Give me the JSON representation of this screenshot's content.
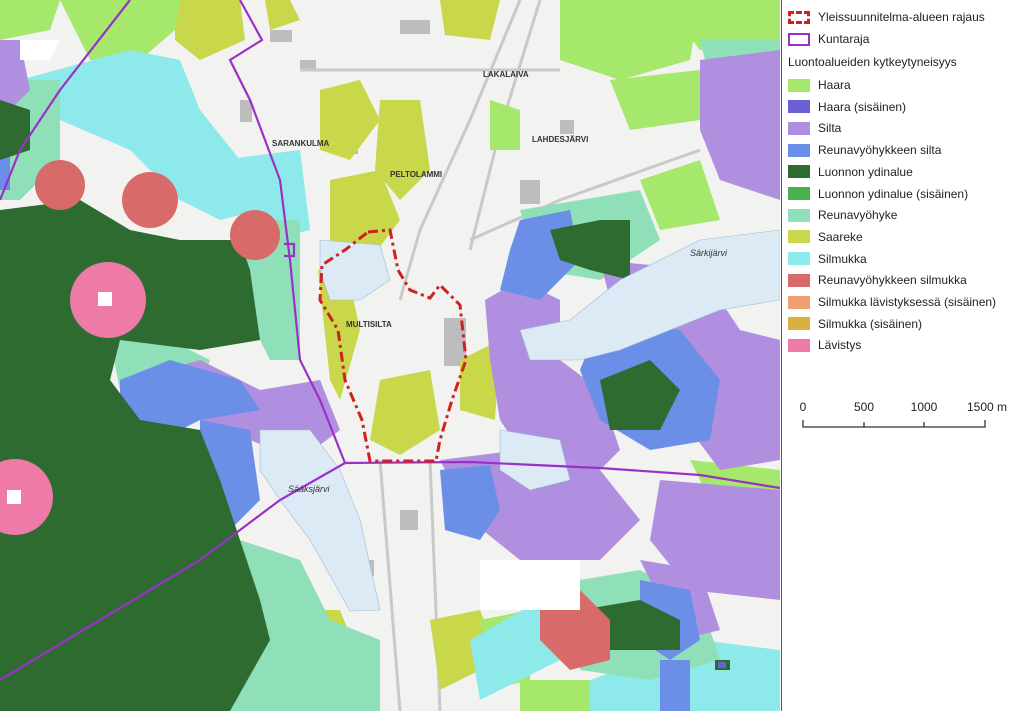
{
  "legend": {
    "boundary_label": "Yleissuunnitelma-alueen rajaus",
    "municipality_label": "Kuntaraja",
    "section_title": "Luontoalueiden kytkeytyneisyys",
    "items": [
      {
        "label": "Haara",
        "color": "#a6e86c"
      },
      {
        "label": "Haara (sisäinen)",
        "color": "#6b5fd6"
      },
      {
        "label": "Silta",
        "color": "#b08fe0"
      },
      {
        "label": "Reunavyöhykkeen silta",
        "color": "#6b8fe6"
      },
      {
        "label": "Luonnon ydinalue",
        "color": "#2e6b30"
      },
      {
        "label": "Luonnon ydinalue (sisäinen)",
        "color": "#4caf50"
      },
      {
        "label": "Reunavyöhyke",
        "color": "#8fe0b8"
      },
      {
        "label": "Saareke",
        "color": "#c8d84a"
      },
      {
        "label": "Silmukka",
        "color": "#8eeaea"
      },
      {
        "label": "Reunavyöhykkeen silmukka",
        "color": "#d96a6a"
      },
      {
        "label": "Silmukka lävistyksessä (sisäinen)",
        "color": "#f0a070"
      },
      {
        "label": "Silmukka (sisäinen)",
        "color": "#dbb040"
      },
      {
        "label": "Lävistys",
        "color": "#ee7aa8"
      }
    ],
    "boundary_color": "#d02020",
    "municipality_color": "#9b30c8"
  },
  "scale_bar": {
    "ticks": [
      "0",
      "500",
      "1000",
      "1500 m"
    ]
  },
  "map_labels": {
    "lakalaiva": "LAKALAIVA",
    "sarankulma": "SARANKULMA",
    "lahdesjarvi": "LAHDESJÄRVI",
    "peltolammi": "PELTOLAMMI",
    "multisilta": "MULTISILTA",
    "sarkijarvi": "Särkijärvi",
    "saaksjarvi": "Sääksjärvi"
  }
}
